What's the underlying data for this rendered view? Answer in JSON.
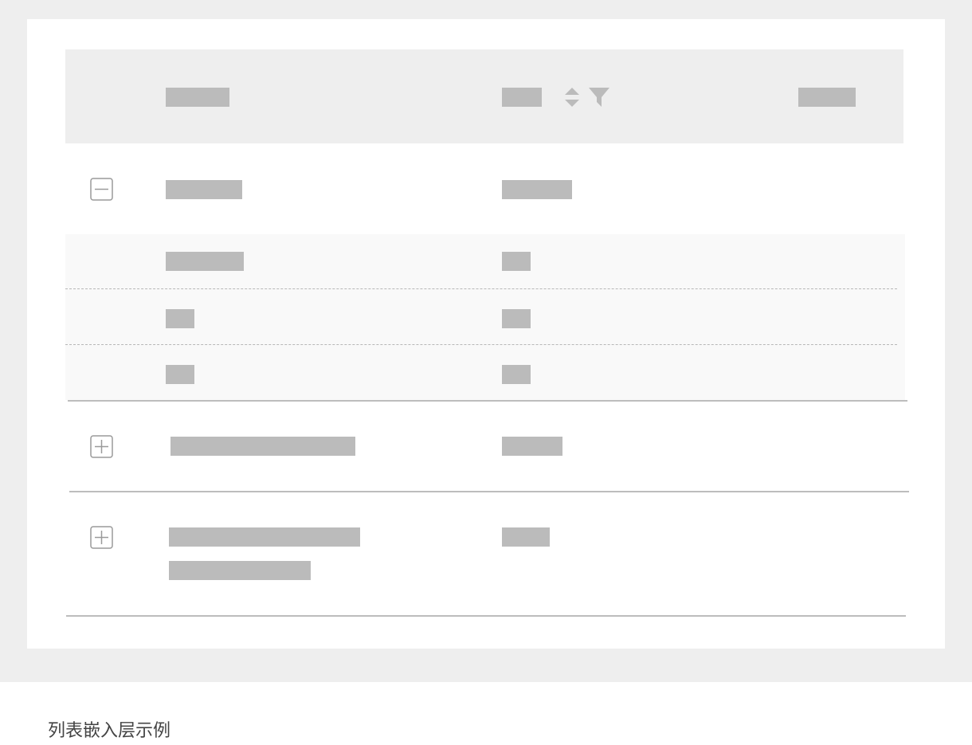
{
  "caption": "列表嵌入层示例",
  "table": {
    "header": {
      "columns": [
        "name-column-header",
        "sortable-filter-column-header",
        "third-column-header"
      ]
    },
    "rows": [
      {
        "state": "expanded",
        "nested_rows": 3
      },
      {
        "state": "collapsed"
      },
      {
        "state": "collapsed"
      }
    ]
  },
  "icons": {
    "collapse": "minus-square-icon",
    "expand": "plus-square-icon",
    "sort": "sort-icon",
    "filter": "filter-icon"
  },
  "colors": {
    "canvas": "#eeeeee",
    "card": "#ffffff",
    "header_bg": "#eeeeee",
    "nested_bg": "#f9f9f9",
    "placeholder": "#bbbbbb",
    "icon": "#999999"
  }
}
